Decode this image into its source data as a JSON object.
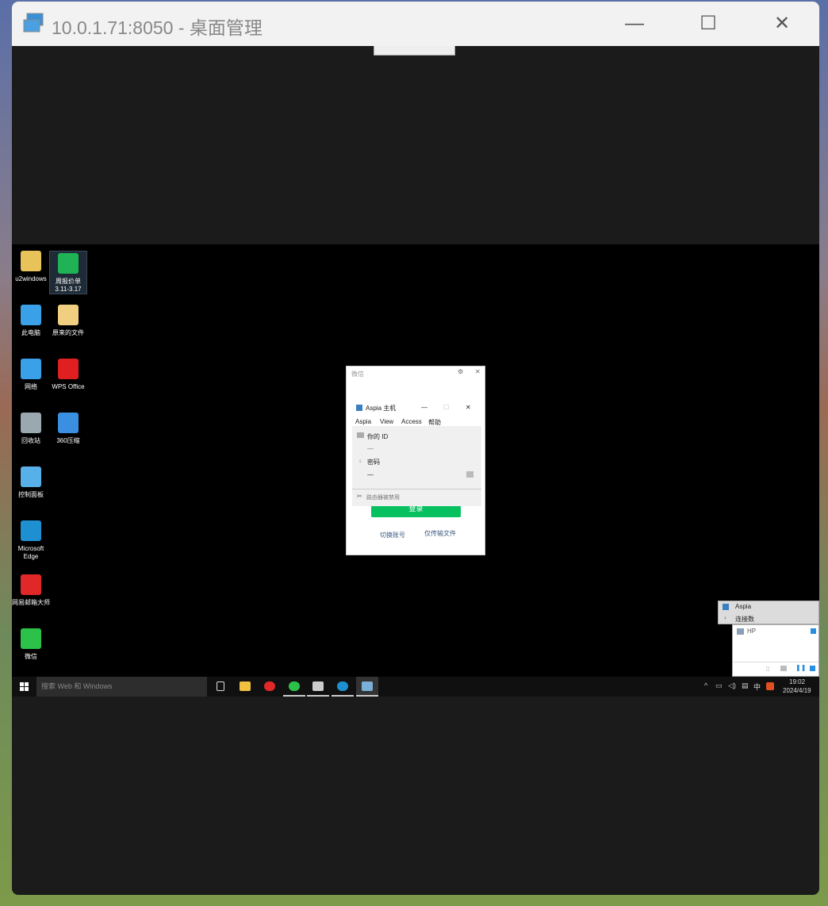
{
  "window": {
    "title": "10.0.1.71:8050 - 桌面管理",
    "minimize": "—",
    "maximize": "☐",
    "close": "✕"
  },
  "desktop": {
    "icons": [
      {
        "label": "u2windows",
        "color": "#e8c35a"
      },
      {
        "label": "周报价单\n3.11-3.17",
        "color": "#1fb355"
      },
      {
        "label": "此电脑",
        "color": "#3aa0e8"
      },
      {
        "label": "原来的文件",
        "color": "#f0d080"
      },
      {
        "label": "网络",
        "color": "#3aa0e8"
      },
      {
        "label": "WPS Office",
        "color": "#e02020"
      },
      {
        "label": "回收站",
        "color": "#9aa8b0"
      },
      {
        "label": "360压缩",
        "color": "#3a8fe0"
      },
      {
        "label": "控制面板",
        "color": "#58b0e8"
      },
      {
        "label": "Microsoft Edge",
        "color": "#1e8fd0"
      },
      {
        "label": "网易邮箱大师",
        "color": "#e02828"
      },
      {
        "label": "微信",
        "color": "#2cc24a"
      }
    ]
  },
  "wechat": {
    "title": "微信",
    "settings_icon": "gear-icon",
    "close": "✕",
    "login": "登录",
    "switch_account": "切换账号",
    "transfer_only": "仅传输文件",
    "accent": "#07c160"
  },
  "aspia": {
    "title": "Aspia 主机",
    "minimize": "—",
    "maximize": "☐",
    "close": "✕",
    "menu": [
      "Aspia",
      "View",
      "Access",
      "帮助"
    ],
    "id_label": "你的 ID",
    "id_value": "—",
    "password_label": "密码",
    "password_value": "—",
    "status": "路由器被禁用"
  },
  "tray_menu": {
    "items": [
      "Aspia",
      "连接数"
    ]
  },
  "connections": {
    "host": "HP"
  },
  "taskbar": {
    "search_placeholder": "搜索 Web 和 Windows",
    "ime": "中",
    "time": "19:02",
    "date": "2024/4/19"
  }
}
